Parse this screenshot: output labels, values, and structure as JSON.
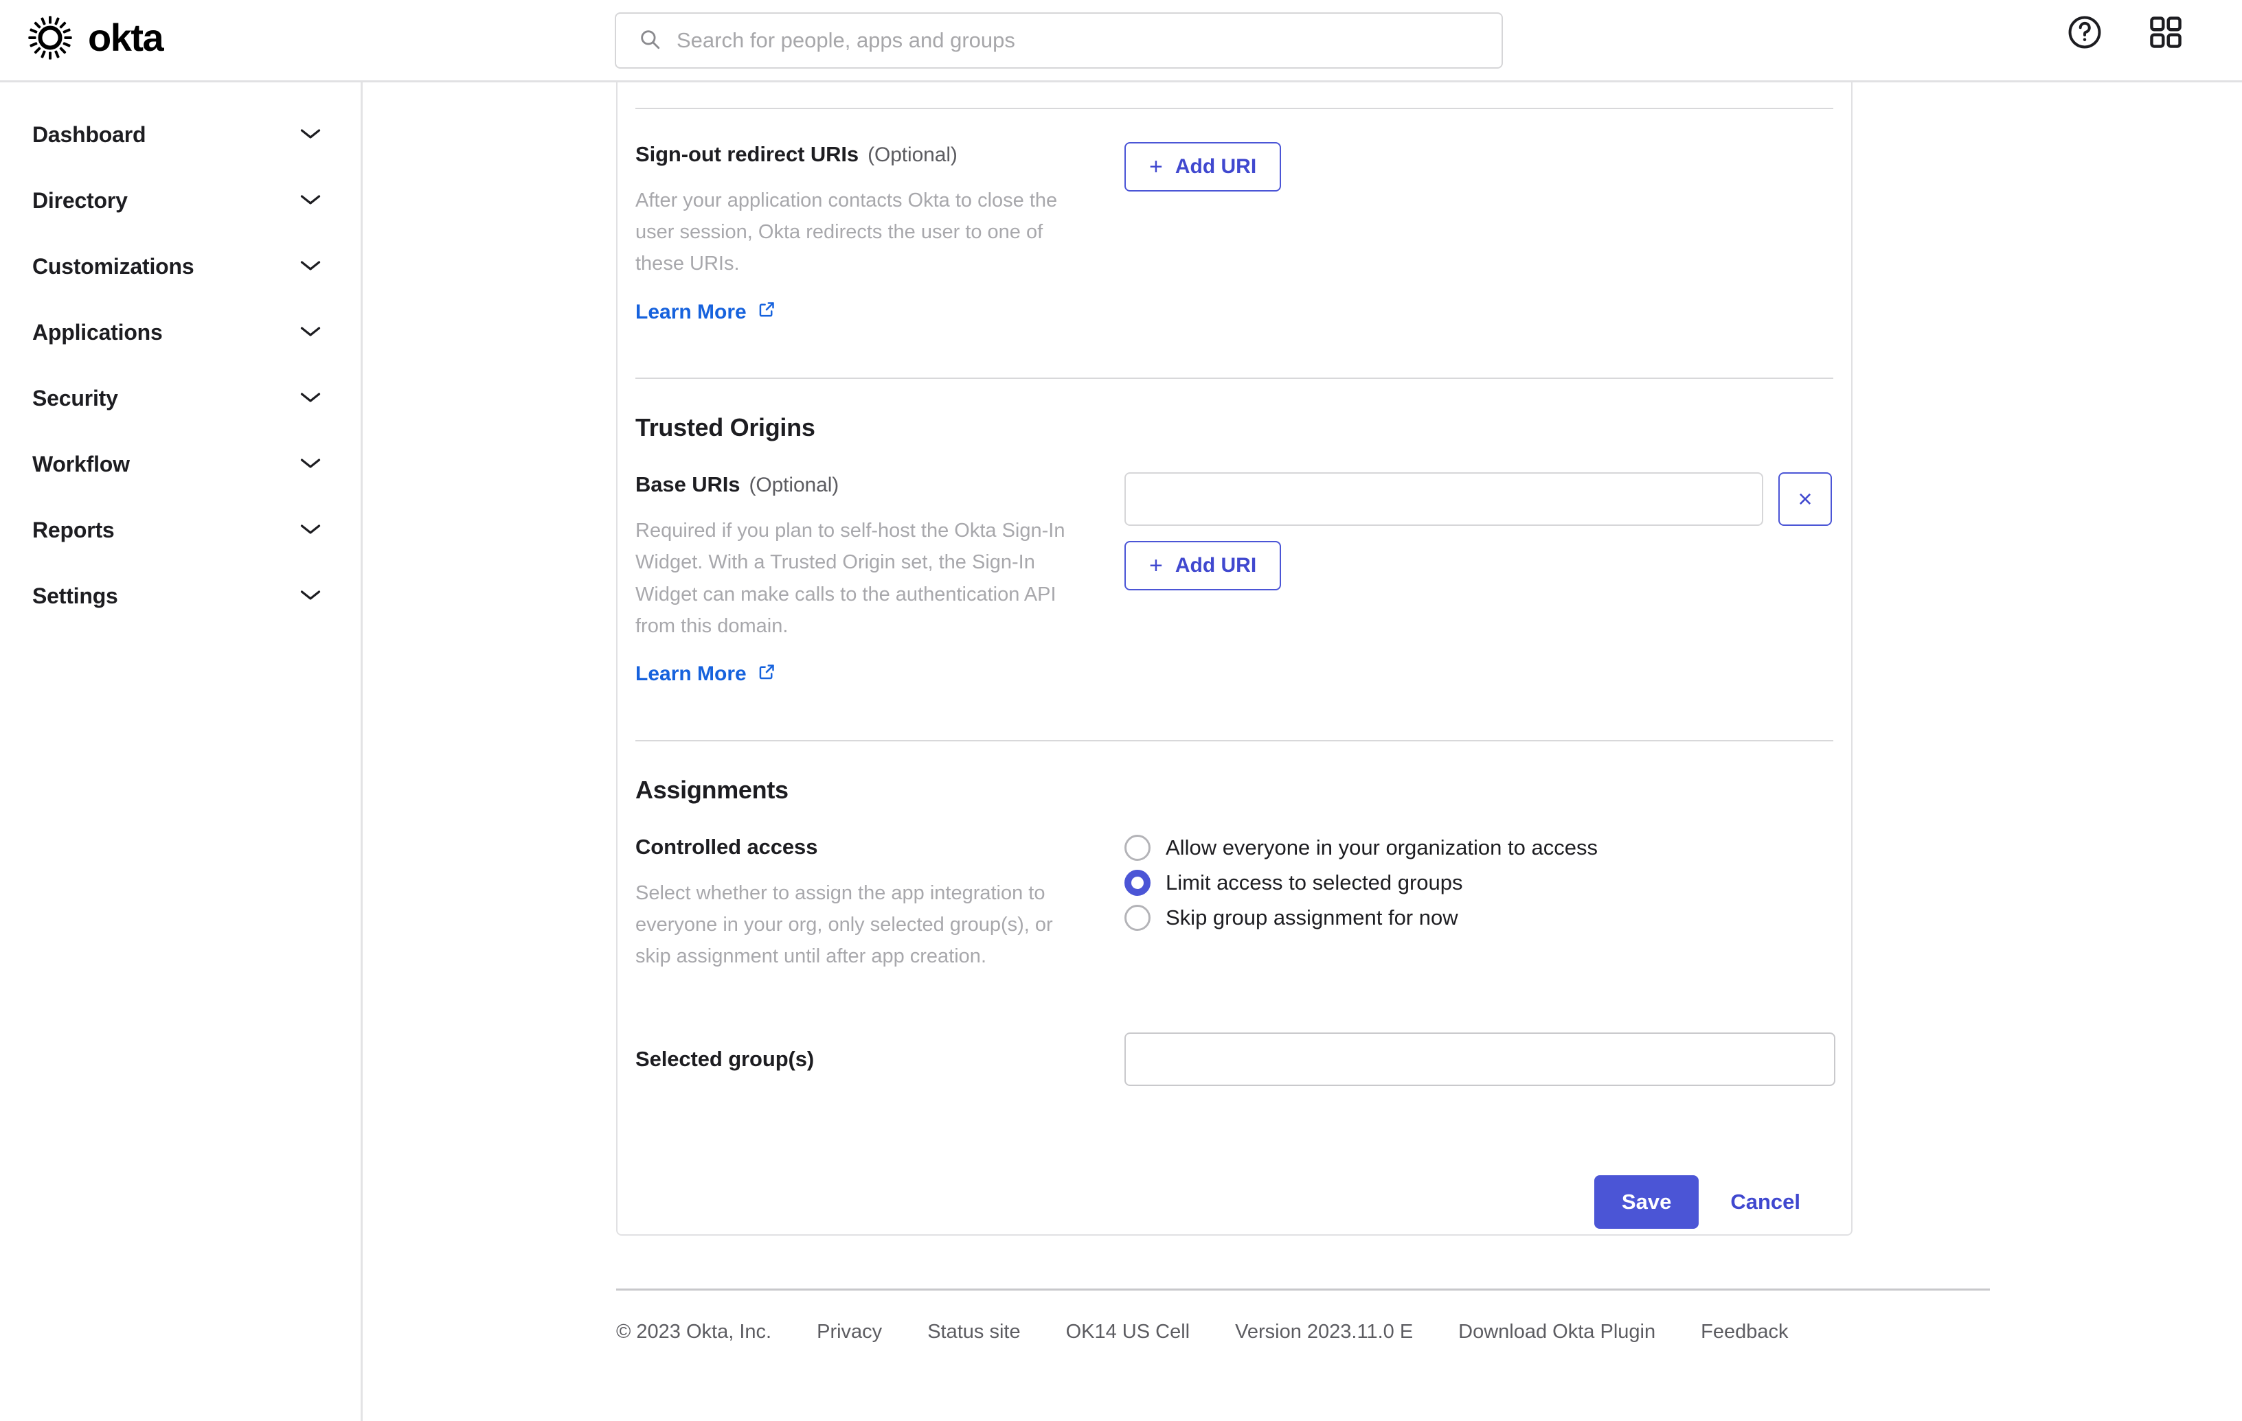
{
  "header": {
    "logo_word": "okta",
    "logo_icon": "okta-sunburst-logo",
    "search": {
      "placeholder": "Search for people, apps and groups",
      "value": "",
      "icon": "search-icon"
    },
    "help_icon": "help-circle-icon",
    "apps_icon": "app-grid-icon"
  },
  "sidebar": {
    "items": [
      {
        "label": "Dashboard",
        "icon": "chevron-down-icon"
      },
      {
        "label": "Directory",
        "icon": "chevron-down-icon"
      },
      {
        "label": "Customizations",
        "icon": "chevron-down-icon"
      },
      {
        "label": "Applications",
        "icon": "chevron-down-icon"
      },
      {
        "label": "Security",
        "icon": "chevron-down-icon"
      },
      {
        "label": "Workflow",
        "icon": "chevron-down-icon"
      },
      {
        "label": "Reports",
        "icon": "chevron-down-icon"
      },
      {
        "label": "Settings",
        "icon": "chevron-down-icon"
      }
    ]
  },
  "main": {
    "signout_redirect": {
      "label": "Sign-out redirect URIs",
      "optional": "(Optional)",
      "helper": "After your application contacts Okta to close the user session, Okta redirects the user to one of these URIs.",
      "learn_more": "Learn More",
      "add_uri_button": "Add URI",
      "plus": "+"
    },
    "trusted_origins": {
      "section_title": "Trusted Origins",
      "label": "Base URIs",
      "optional": "(Optional)",
      "helper": "Required if you plan to self-host the Okta Sign-In Widget. With a Trusted Origin set, the Sign-In Widget can make calls to the authentication API from this domain.",
      "learn_more": "Learn More",
      "base_uri_value": "",
      "remove_button": "×",
      "add_uri_button": "Add URI",
      "plus": "+"
    },
    "assignments": {
      "section_title": "Assignments",
      "controlled_access": {
        "label": "Controlled access",
        "helper": "Select whether to assign the app integration to everyone in your org, only selected group(s), or skip assignment until after app creation.",
        "options": [
          {
            "label": "Allow everyone in your organization to access",
            "checked": false
          },
          {
            "label": "Limit access to selected groups",
            "checked": true
          },
          {
            "label": "Skip group assignment for now",
            "checked": false
          }
        ]
      },
      "selected_groups": {
        "label": "Selected group(s)",
        "value": ""
      }
    },
    "form_actions": {
      "save_label": "Save",
      "cancel_label": "Cancel"
    }
  },
  "footer": {
    "copyright": "© 2023 Okta, Inc.",
    "links": [
      "Privacy",
      "Status site",
      "OK14 US Cell",
      "Version 2023.11.0 E",
      "Download Okta Plugin",
      "Feedback"
    ]
  },
  "colors": {
    "accent_blue": "#4b55d6",
    "link_blue": "#1662dd",
    "border_gray": "#d6d6d8",
    "helper_gray": "#a8a8ac"
  }
}
